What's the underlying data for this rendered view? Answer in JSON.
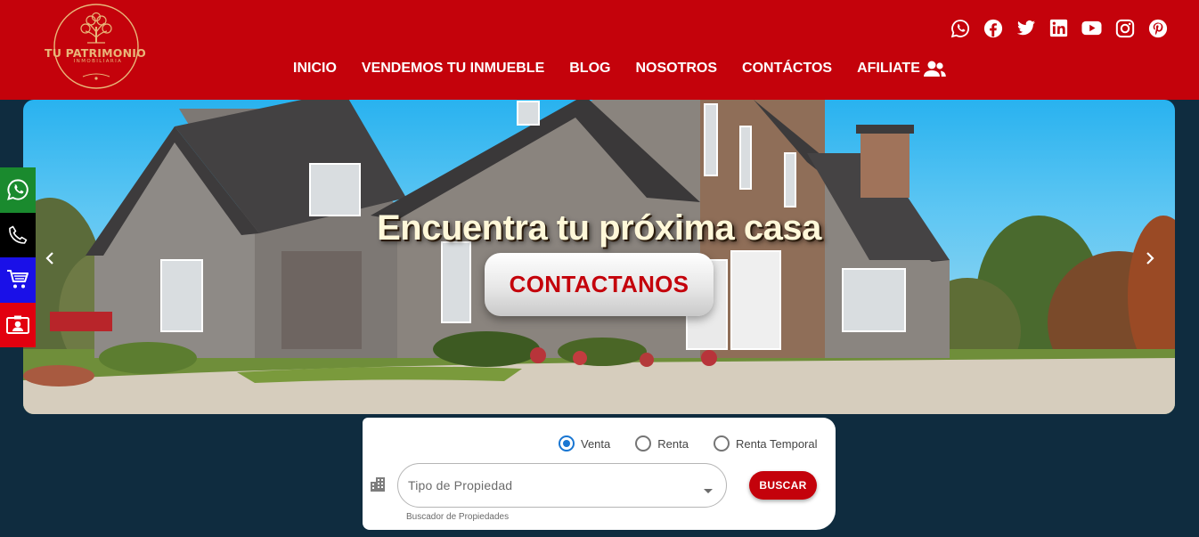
{
  "brand": {
    "name": "TU PATRIMONIO",
    "subtitle": "INMOBILIARIA"
  },
  "nav": {
    "items": [
      "INICIO",
      "VENDEMOS TU INMUEBLE",
      "BLOG",
      "NOSOTROS",
      "CONTÁCTOS",
      "AFILIATE"
    ]
  },
  "social_icons": [
    "whatsapp-icon",
    "facebook-icon",
    "twitter-icon",
    "linkedin-icon",
    "youtube-icon",
    "instagram-icon",
    "pinterest-icon"
  ],
  "hero": {
    "title": "Encuentra tu próxima casa",
    "cta_label": "CONTACTANOS"
  },
  "floating_contacts": [
    {
      "icon": "whatsapp-icon",
      "color": "#1a8a2e"
    },
    {
      "icon": "phone-icon",
      "color": "#000000"
    },
    {
      "icon": "cart-icon",
      "color": "#1a10e8"
    },
    {
      "icon": "contact-card-icon",
      "color": "#e2000f"
    }
  ],
  "search": {
    "operations": [
      {
        "label": "Venta",
        "checked": true
      },
      {
        "label": "Renta",
        "checked": false
      },
      {
        "label": "Renta Temporal",
        "checked": false
      }
    ],
    "property_type_placeholder": "Tipo de Propiedad",
    "helper_text": "Buscador de Propiedades",
    "button_label": "BUSCAR"
  },
  "colors": {
    "header_bg": "#c4020b",
    "page_bg": "#0f2c3f",
    "accent_gold": "#e8b679",
    "radio_blue": "#1976d2"
  }
}
